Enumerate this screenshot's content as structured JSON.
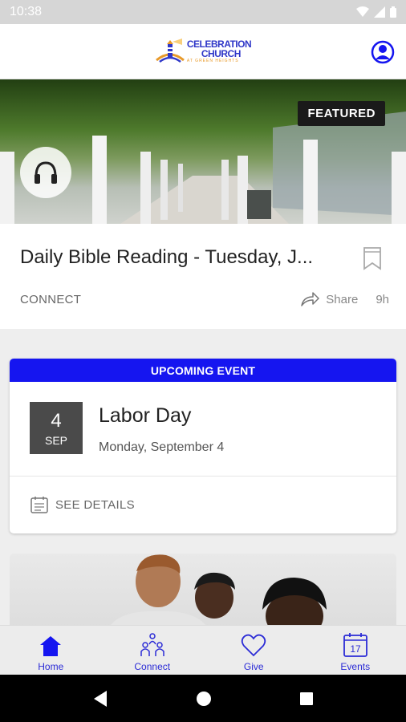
{
  "status_bar": {
    "time": "10:38"
  },
  "header": {
    "logo": {
      "line1": "CELEBRATION",
      "line2": "CHURCH",
      "line3": "AT GREEN HEIGHTS"
    }
  },
  "featured": {
    "badge": "FEATURED",
    "title": "Daily Bible Reading - Tuesday, J...",
    "category": "CONNECT",
    "share_label": "Share",
    "time_ago": "9h"
  },
  "event": {
    "header": "UPCOMING EVENT",
    "day": "4",
    "month": "SEP",
    "title": "Labor Day",
    "date": "Monday, September 4",
    "details_label": "SEE DETAILS"
  },
  "tabs": [
    {
      "label": "Home",
      "icon": "home-icon"
    },
    {
      "label": "Connect",
      "icon": "people-icon"
    },
    {
      "label": "Give",
      "icon": "heart-icon"
    },
    {
      "label": "Events",
      "icon": "calendar-icon"
    }
  ],
  "events_icon_day": "17",
  "colors": {
    "accent": "#1515f0",
    "tab": "#2b2bd6",
    "date_box": "#4a4a4a"
  }
}
